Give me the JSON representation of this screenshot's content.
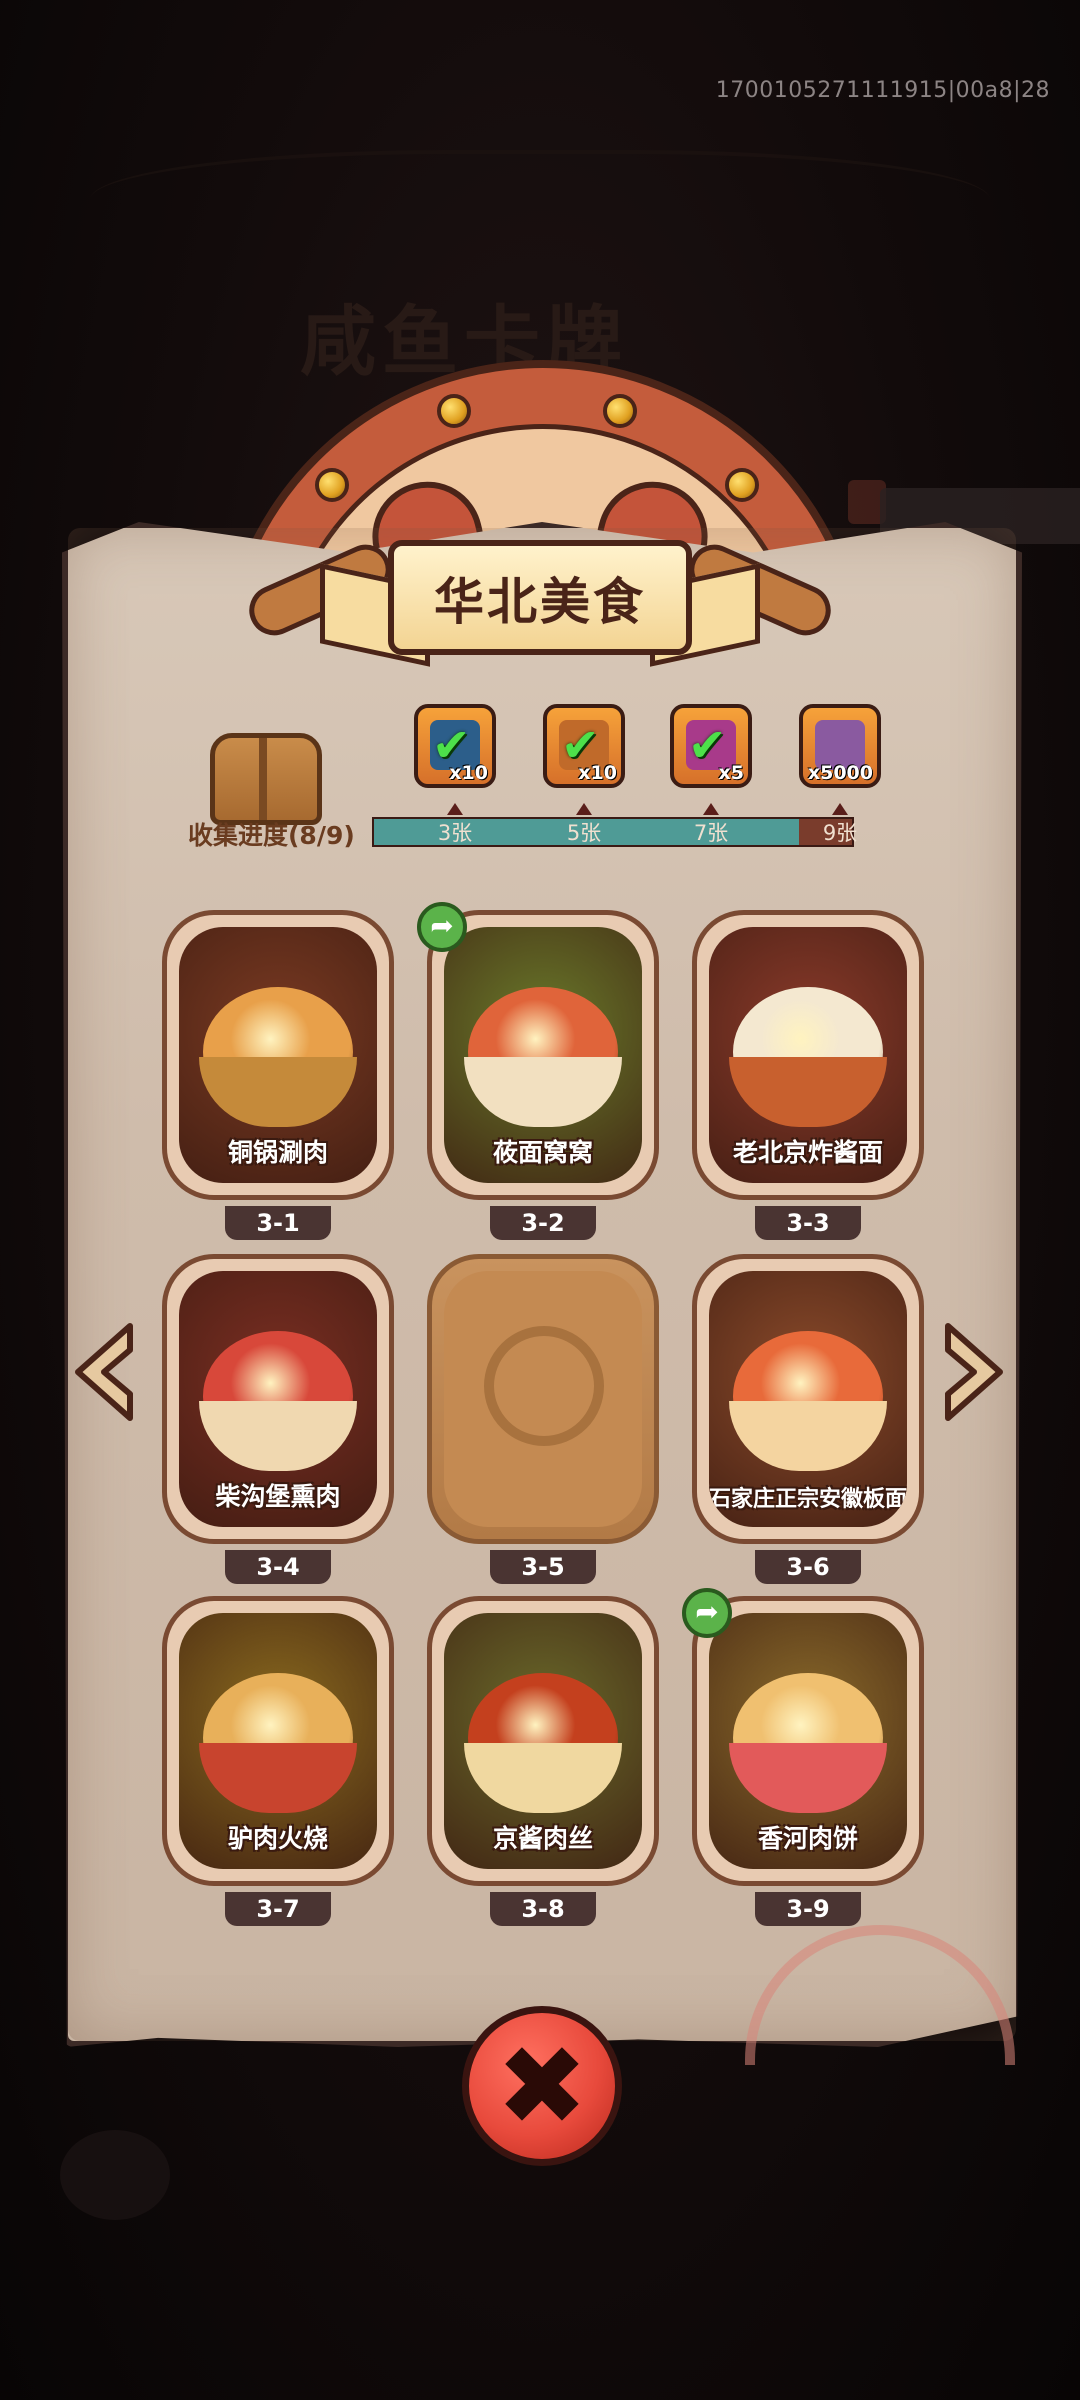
{
  "device_id": "1700105271111915|00a8|28",
  "background_title": "咸鱼卡牌",
  "panel": {
    "title": "华北美食",
    "progress_label": "收集进度(8/9)",
    "progress_collected": 8,
    "progress_total": 9
  },
  "rewards": [
    {
      "name": "blue-chest-icon",
      "count": "x10",
      "claimed": true,
      "color": "#2c5e8a",
      "threshold": "3张"
    },
    {
      "name": "orange-chest-icon",
      "count": "x10",
      "claimed": true,
      "color": "#c06a2a",
      "threshold": "5张"
    },
    {
      "name": "purple-orb-icon",
      "count": "x5",
      "claimed": true,
      "color": "#a83a8a",
      "threshold": "7张"
    },
    {
      "name": "crystal-icon",
      "count": "x5000",
      "claimed": false,
      "color": "#8a5aa0",
      "threshold": "9张"
    }
  ],
  "cards": [
    {
      "name": "铜锅涮肉",
      "id": "3-1",
      "unlocked": true,
      "share": false,
      "bg": "#7a3a22",
      "dish": "#e8a04a",
      "bowl": "#c58a3a"
    },
    {
      "name": "莜面窝窝",
      "id": "3-2",
      "unlocked": true,
      "share": true,
      "bg": "#6a7a2a",
      "dish": "#e0643a",
      "bowl": "#f2e0c0"
    },
    {
      "name": "老北京炸酱面",
      "id": "3-3",
      "unlocked": true,
      "share": false,
      "bg": "#8a3a2a",
      "dish": "#f4e8d0",
      "bowl": "#c8602e"
    },
    {
      "name": "柴沟堡熏肉",
      "id": "3-4",
      "unlocked": true,
      "share": false,
      "bg": "#7a2e22",
      "dish": "#d8483a",
      "bowl": "#f0d8b0"
    },
    {
      "name": "",
      "id": "3-5",
      "unlocked": false,
      "share": false,
      "bg": "#c48a52",
      "dish": "#c48a52",
      "bowl": "#c48a52"
    },
    {
      "name": "石家庄正宗安徽板面",
      "id": "3-6",
      "unlocked": true,
      "share": false,
      "bg": "#8a4a2a",
      "dish": "#e86a3a",
      "bowl": "#f4d4a0"
    },
    {
      "name": "驴肉火烧",
      "id": "3-7",
      "unlocked": true,
      "share": false,
      "bg": "#8a6a1e",
      "dish": "#e8b05a",
      "bowl": "#c8442e"
    },
    {
      "name": "京酱肉丝",
      "id": "3-8",
      "unlocked": true,
      "share": false,
      "bg": "#6a6a2a",
      "dish": "#c4401e",
      "bowl": "#f0d8a0"
    },
    {
      "name": "香河肉饼",
      "id": "3-9",
      "unlocked": true,
      "share": true,
      "bg": "#8a6a2a",
      "dish": "#f0c070",
      "bowl": "#e25a5a"
    }
  ],
  "buttons": {
    "close": "✖",
    "prev": "prev-arrow-icon",
    "next": "next-arrow-icon",
    "share_glyph": "➦"
  }
}
